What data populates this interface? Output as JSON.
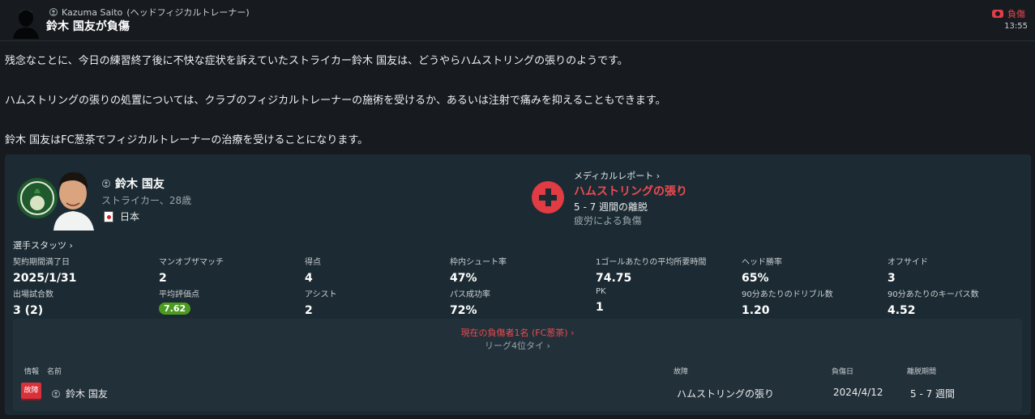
{
  "header": {
    "sender_name": "Kazuma Saito",
    "sender_role": "(ヘッドフィジカルトレーナー)",
    "title": "鈴木 国友が負傷",
    "tag": "負傷",
    "time": "13:55"
  },
  "body": {
    "p1": "残念なことに、今日の練習終了後に不快な症状を訴えていたストライカー鈴木 国友は、どうやらハムストリングの張りのようです。",
    "p2": "ハムストリングの張りの処置については、クラブのフィジカルトレーナーの施術を受けるか、あるいは注射で痛みを抑えることもできます。",
    "p3": "鈴木 国友はFC葱茶でフィジカルトレーナーの治療を受けることになります。"
  },
  "player": {
    "name": "鈴木 国友",
    "role": "ストライカー、28歳",
    "nation": "日本"
  },
  "medical": {
    "link": "メディカルレポート ›",
    "injury": "ハムストリングの張り",
    "duration": "5 - 7 週間の離脱",
    "cause": "疲労による負傷"
  },
  "stats_link": "選手スタッツ ›",
  "stats": [
    {
      "label": "契約期間満了日",
      "value": "2025/1/31"
    },
    {
      "label": "マンオブザマッチ",
      "value": "2"
    },
    {
      "label": "得点",
      "value": "4"
    },
    {
      "label": "枠内シュート率",
      "value": "47%"
    },
    {
      "label": "1ゴールあたりの平均所要時間",
      "value": "74.75"
    },
    {
      "label": "ヘッド勝率",
      "value": "65%"
    },
    {
      "label": "オフサイド",
      "value": "3"
    },
    {
      "label": "出場試合数",
      "value": "3 (2)"
    },
    {
      "label": "平均評価点",
      "value": "7.62"
    },
    {
      "label": "アシスト",
      "value": "2"
    },
    {
      "label": "パス成功率",
      "value": "72%"
    },
    {
      "label": "PK",
      "value": "1"
    },
    {
      "label": "90分あたりのドリブル数",
      "value": "1.20"
    },
    {
      "label": "90分あたりのキーパス数",
      "value": "4.52"
    }
  ],
  "injuries": {
    "current_link": "現在の負傷者1名 (FC葱茶) ›",
    "league_link": "リーグ4位タイ ›",
    "columns": {
      "info": "情報",
      "name": "名前",
      "injury": "故障",
      "date": "負傷日",
      "period": "離脱期間"
    },
    "rows": [
      {
        "badge": "故障",
        "name": "鈴木 国友",
        "injury": "ハムストリングの張り",
        "date": "2024/4/12",
        "period": "5 - 7 週間"
      }
    ]
  },
  "colors": {
    "accent_red": "#e8454f",
    "rating_green": "#4a9b1f",
    "card_bg": "#1c2b33"
  }
}
